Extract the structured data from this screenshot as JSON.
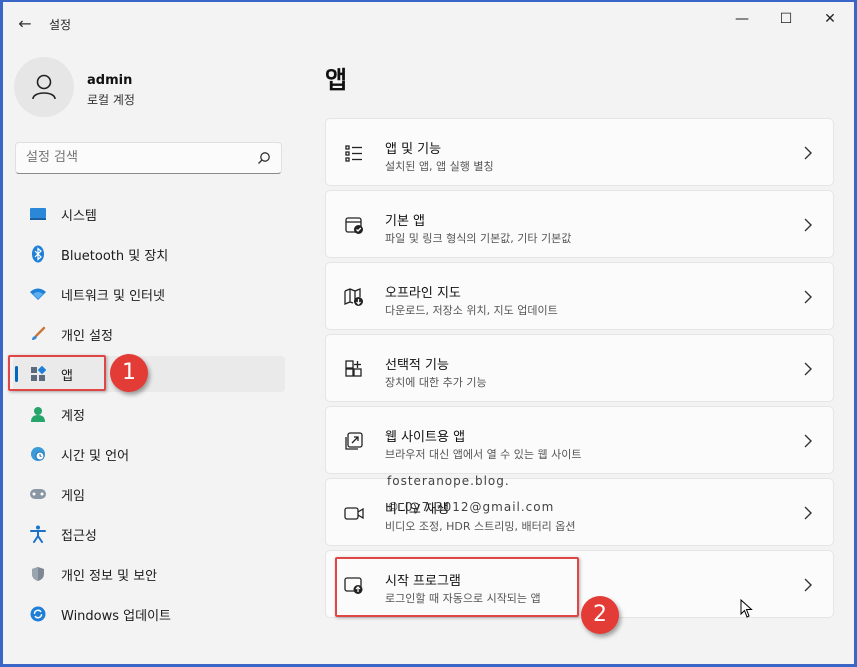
{
  "window": {
    "title": "설정",
    "back_glyph": "←",
    "controls": {
      "minimize": "—",
      "maximize": "☐",
      "close": "✕"
    }
  },
  "profile": {
    "name": "admin",
    "account_type": "로컬 계정"
  },
  "search": {
    "placeholder": "설정 검색"
  },
  "sidebar": {
    "items": [
      {
        "label": "시스템",
        "icon": "system-icon"
      },
      {
        "label": "Bluetooth 및 장치",
        "icon": "bluetooth-icon"
      },
      {
        "label": "네트워크 및 인터넷",
        "icon": "wifi-icon"
      },
      {
        "label": "개인 설정",
        "icon": "brush-icon"
      },
      {
        "label": "앱",
        "icon": "apps-icon",
        "active": true
      },
      {
        "label": "계정",
        "icon": "person-icon"
      },
      {
        "label": "시간 및 언어",
        "icon": "globe-clock-icon"
      },
      {
        "label": "게임",
        "icon": "gamepad-icon"
      },
      {
        "label": "접근성",
        "icon": "accessibility-icon"
      },
      {
        "label": "개인 정보 및 보안",
        "icon": "shield-icon"
      },
      {
        "label": "Windows 업데이트",
        "icon": "update-icon"
      }
    ]
  },
  "main": {
    "title": "앱",
    "cards": [
      {
        "title": "앱 및 기능",
        "subtitle": "설치된 앱, 앱 실행 별칭",
        "icon": "list-icon"
      },
      {
        "title": "기본 앱",
        "subtitle": "파일 및 링크 형식의 기본값, 기타 기본값",
        "icon": "default-apps-icon"
      },
      {
        "title": "오프라인 지도",
        "subtitle": "다운로드, 저장소 위치, 지도 업데이트",
        "icon": "map-download-icon"
      },
      {
        "title": "선택적 기능",
        "subtitle": "장치에 대한 추가 기능",
        "icon": "add-apps-icon"
      },
      {
        "title": "웹 사이트용 앱",
        "subtitle": "브라우저 대신 앱에서 열 수 있는 웹 사이트",
        "icon": "web-app-icon"
      },
      {
        "title": "비디오 재생",
        "subtitle": "비디오 조정, HDR 스트리밍, 배터리 옵션",
        "icon": "video-icon"
      },
      {
        "title": "시작 프로그램",
        "subtitle": "로그인할 때 자동으로 시작되는 앱",
        "icon": "startup-icon"
      }
    ]
  },
  "annotations": {
    "badge_1": "1",
    "badge_2": "2",
    "watermark_line1": "fosteranope.blog.",
    "watermark_line2": "© 0y7.3012@gmail.com"
  },
  "colors": {
    "accent": "#0067c0",
    "annotation_red": "#e33b35",
    "window_border": "#3a67c7"
  }
}
